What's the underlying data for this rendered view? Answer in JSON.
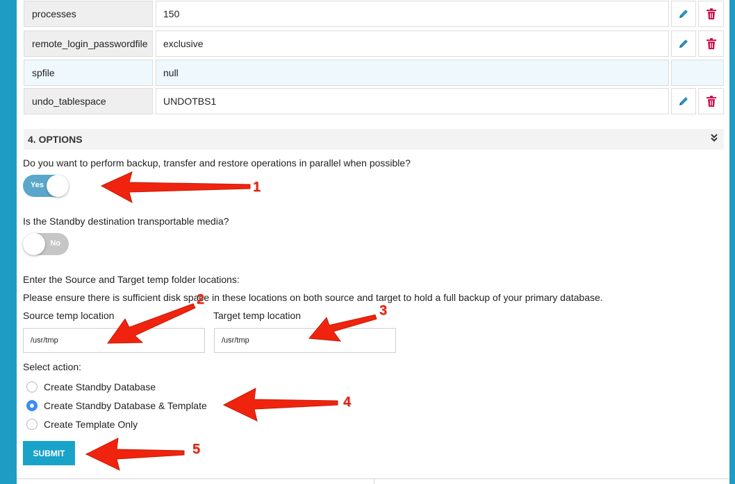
{
  "params": [
    {
      "name": "processes",
      "value": "150",
      "actions": true
    },
    {
      "name": "remote_login_passwordfile",
      "value": "exclusive",
      "actions": true
    },
    {
      "name": "spfile",
      "value": "null",
      "actions": false
    },
    {
      "name": "undo_tablespace",
      "value": "UNDOTBS1",
      "actions": true
    }
  ],
  "options": {
    "title": "4. OPTIONS",
    "q_parallel": "Do you want to perform backup, transfer and restore operations in parallel when possible?",
    "parallel_toggle": "Yes",
    "q_transportable": "Is the Standby destination transportable media?",
    "transportable_toggle": "No",
    "temp_heading": "Enter the Source and Target temp folder locations:",
    "disk_note": "Please ensure there is sufficient disk space in these locations on both source and target to hold a full backup of your primary database.",
    "source_label": "Source temp location",
    "source_value": "/usr/tmp",
    "target_label": "Target temp location",
    "target_value": "/usr/tmp",
    "select_action_label": "Select action:",
    "actions": [
      {
        "label": "Create Standby Database",
        "selected": false
      },
      {
        "label": "Create Standby Database & Template",
        "selected": true
      },
      {
        "label": "Create Template Only",
        "selected": false
      }
    ],
    "submit_label": "SUBMIT"
  },
  "annotations": [
    "1",
    "2",
    "3",
    "4",
    "5"
  ],
  "colors": {
    "accent": "#19a3c9",
    "toggle_on": "#5ba7cb",
    "annotation": "#e8200d",
    "delete": "#d0104c",
    "edit": "#2e8fc0"
  }
}
